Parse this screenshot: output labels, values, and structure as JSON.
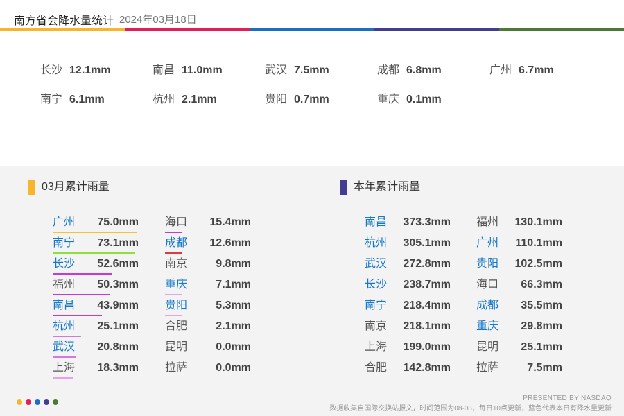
{
  "header": {
    "title": "南方省会降水量统计",
    "date": "2024年03月18日"
  },
  "colors": {
    "stripe": [
      "#f7b52c",
      "#e0205a",
      "#1a6fc0",
      "#433d92",
      "#4a7a33"
    ],
    "monthly_accent": "#f7b52c",
    "yearly_accent": "#433d92",
    "blue_text": "#1478c8"
  },
  "chart_data": [
    {
      "type": "table",
      "title": "",
      "unit": "mm",
      "rows": [
        {
          "city": "长沙",
          "value": "12.1mm"
        },
        {
          "city": "南昌",
          "value": "11.0mm"
        },
        {
          "city": "武汉",
          "value": "7.5mm"
        },
        {
          "city": "成都",
          "value": "6.8mm"
        },
        {
          "city": "广州",
          "value": "6.7mm"
        },
        {
          "city": "南宁",
          "value": "6.1mm"
        },
        {
          "city": "杭州",
          "value": "2.1mm"
        },
        {
          "city": "贵阳",
          "value": "0.7mm"
        },
        {
          "city": "重庆",
          "value": "0.1mm"
        }
      ]
    },
    {
      "type": "table",
      "title": "03月累计雨量",
      "rows": [
        {
          "city": "广州",
          "value": "75.0mm",
          "highlight": true,
          "line_color": "#f7c22c"
        },
        {
          "city": "南宁",
          "value": "73.1mm",
          "highlight": true,
          "line_color": "#8ee03a"
        },
        {
          "city": "长沙",
          "value": "52.6mm",
          "highlight": true,
          "line_color": "#c43ad6"
        },
        {
          "city": "福州",
          "value": "50.3mm",
          "highlight": false,
          "line_color": "#c43ad6"
        },
        {
          "city": "南昌",
          "value": "43.9mm",
          "highlight": true,
          "line_color": "#c43ad6"
        },
        {
          "city": "杭州",
          "value": "25.1mm",
          "highlight": true,
          "line_color": "#d576e3"
        },
        {
          "city": "武汉",
          "value": "20.8mm",
          "highlight": true,
          "line_color": "#d576e3"
        },
        {
          "city": "上海",
          "value": "18.3mm",
          "highlight": false,
          "line_color": "#e6a3ec"
        },
        {
          "city": "海口",
          "value": "15.4mm",
          "highlight": false,
          "line_color": "#c43ad6"
        },
        {
          "city": "成都",
          "value": "12.6mm",
          "highlight": true,
          "line_color": "#e03a3a"
        },
        {
          "city": "南京",
          "value": "9.8mm",
          "highlight": false,
          "line_color": ""
        },
        {
          "city": "重庆",
          "value": "7.1mm",
          "highlight": true,
          "line_color": "#e6a3ec"
        },
        {
          "city": "贵阳",
          "value": "5.3mm",
          "highlight": true,
          "line_color": "#e6a3ec"
        },
        {
          "city": "合肥",
          "value": "2.1mm",
          "highlight": false,
          "line_color": ""
        },
        {
          "city": "昆明",
          "value": "0.0mm",
          "highlight": false,
          "line_color": ""
        },
        {
          "city": "拉萨",
          "value": "0.0mm",
          "highlight": false,
          "line_color": ""
        }
      ]
    },
    {
      "type": "table",
      "title": "本年累计雨量",
      "rows": [
        {
          "city": "南昌",
          "value": "373.3mm",
          "highlight": true
        },
        {
          "city": "杭州",
          "value": "305.1mm",
          "highlight": true
        },
        {
          "city": "武汉",
          "value": "272.8mm",
          "highlight": true
        },
        {
          "city": "长沙",
          "value": "238.7mm",
          "highlight": true
        },
        {
          "city": "南宁",
          "value": "218.4mm",
          "highlight": true
        },
        {
          "city": "南京",
          "value": "218.1mm",
          "highlight": false
        },
        {
          "city": "上海",
          "value": "199.0mm",
          "highlight": false
        },
        {
          "city": "合肥",
          "value": "142.8mm",
          "highlight": false
        },
        {
          "city": "福州",
          "value": "130.1mm",
          "highlight": false
        },
        {
          "city": "广州",
          "value": "110.1mm",
          "highlight": true
        },
        {
          "city": "贵阳",
          "value": "102.5mm",
          "highlight": true
        },
        {
          "city": "海口",
          "value": "66.3mm",
          "highlight": false
        },
        {
          "city": "成都",
          "value": "35.5mm",
          "highlight": true
        },
        {
          "city": "重庆",
          "value": "29.8mm",
          "highlight": true
        },
        {
          "city": "昆明",
          "value": "25.1mm",
          "highlight": false
        },
        {
          "city": "拉萨",
          "value": "7.5mm",
          "highlight": false
        }
      ]
    }
  ],
  "footer": {
    "presented": "PRESENTED BY NASDAQ",
    "note": "数据收集自国际交换站报文，时间范围为08-08，每日10点更新，蓝色代表本日有降水量更新"
  }
}
